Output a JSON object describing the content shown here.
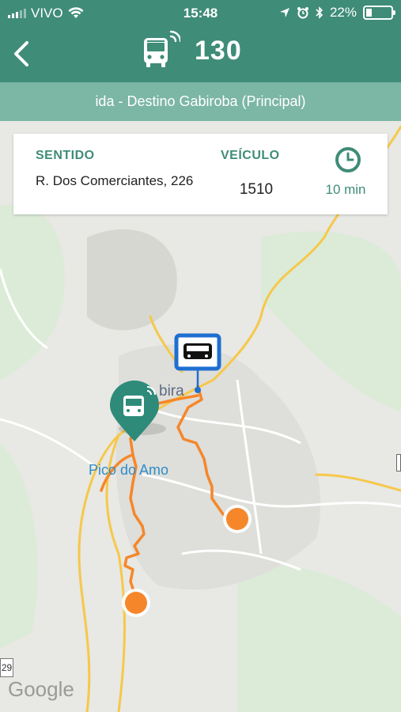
{
  "status_bar": {
    "carrier": "VIVO",
    "time": "15:48",
    "battery_percent": "22%",
    "battery_level": 0.22,
    "icons": [
      "signal-icon",
      "wifi-icon",
      "location-arrow-icon",
      "alarm-icon",
      "bluetooth-icon",
      "battery-icon"
    ]
  },
  "nav": {
    "back_icon": "chevron-left-icon",
    "bus_icon": "bus-wifi-icon",
    "route_number": "130"
  },
  "direction_banner": "ida - Destino Gabiroba (Principal)",
  "info_card": {
    "sentido_label": "SENTIDO",
    "address": "R. Dos Comerciantes, 226",
    "veiculo_label": "VEÍCULO",
    "vehicle_number": "1510",
    "clock_icon": "clock-icon",
    "eta": "10 min"
  },
  "map": {
    "place_label": "Pico do Amo",
    "place_label_2": "bira",
    "road_shield": "29",
    "attribution": "Google",
    "markers": [
      "bus-stop-marker",
      "bus-location-pin",
      "route-endpoint-marker",
      "route-endpoint-marker"
    ]
  },
  "colors": {
    "primary": "#3f8c78",
    "banner": "#7cb6a4",
    "route": "#f5872a",
    "stop_blue": "#1f6fd1",
    "road_yellow": "#f6c84a"
  }
}
